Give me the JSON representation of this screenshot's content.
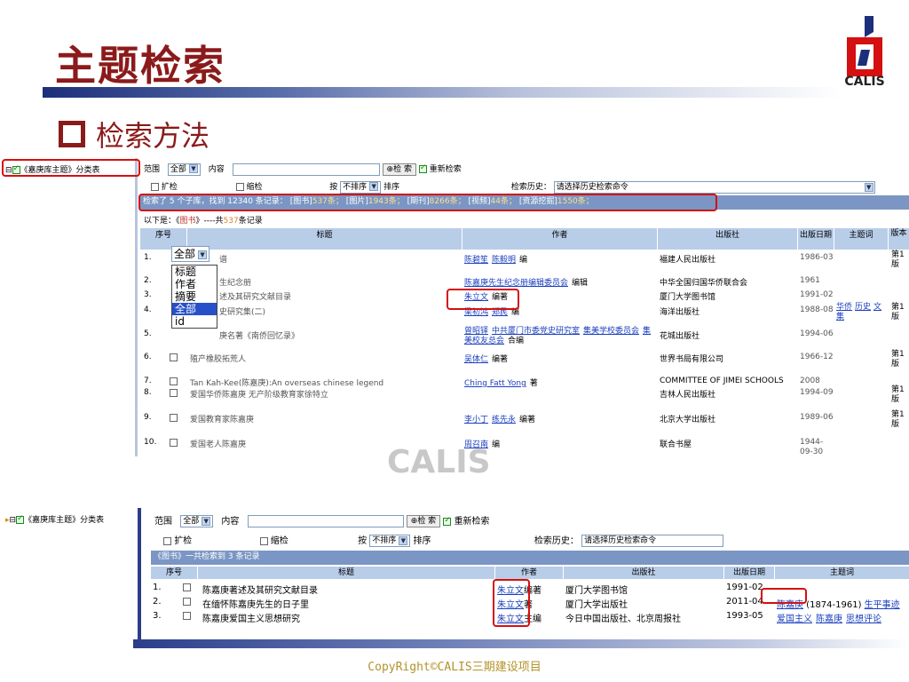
{
  "slide": {
    "title": "主题检索",
    "subtitle": "检索方法",
    "logo_text": "CALIS",
    "watermark": "CALIS",
    "copyright": "CopyRight©CALIS三期建设项目"
  },
  "colors": {
    "title": "#8b1a1a",
    "accent_blue": "#1c2f7a",
    "highlight_red": "#d41010",
    "link": "#1a3fbf"
  },
  "shot1": {
    "tree_label": "《嘉庚库主题》分类表",
    "scope_label": "范围",
    "scope_value": "全部",
    "content_label": "内容",
    "search_btn": "检 索",
    "rescan_label": "重新检索",
    "expand_label": "扩检",
    "narrow_label": "缩检",
    "by_label": "按",
    "sort_value": "不排序",
    "sort_label": "排序",
    "history_label": "检索历史：",
    "history_value": "请选择历史检索命令",
    "summary_prefix": "检索了 5 个子库，找到 12340 条记录：",
    "libs": [
      {
        "name": "图书",
        "count": "537条；"
      },
      {
        "name": "图片",
        "count": "1943条；"
      },
      {
        "name": "期刊",
        "count": "8266条；"
      },
      {
        "name": "视频",
        "count": "44条；"
      },
      {
        "name": "资源挖掘",
        "count": "1550条；"
      }
    ],
    "below_prefix": "以下是：《",
    "below_lib": "图书",
    "below_mid": "》----共",
    "below_count": "537",
    "below_suffix": "条记录",
    "headers": [
      "序号",
      "标题",
      "作者",
      "出版社",
      "出版日期",
      "主题词",
      "版本"
    ],
    "dropdown": {
      "value": "全部",
      "options": [
        "标题",
        "作者",
        "摘要",
        "全部",
        "id"
      ]
    },
    "rows": [
      {
        "no": "1.",
        "title": "谱",
        "authors": [
          "陈碧笙",
          "陈毅明"
        ],
        "role": "编",
        "pub": "福建人民出版社",
        "date": "1986-03",
        "subj": [],
        "ed": "第1版"
      },
      {
        "no": "2.",
        "title": "生纪念册",
        "authors": [
          "陈嘉庚先生纪念册编辑委员会"
        ],
        "role": "编辑",
        "pub": "中华全国归国华侨联合会",
        "date": "1961",
        "subj": [],
        "ed": ""
      },
      {
        "no": "3.",
        "title": "述及其研究文献目录",
        "authors": [
          "朱立文"
        ],
        "role": "编著",
        "pub": "厦门大学图书馆",
        "date": "1991-02",
        "subj": [],
        "ed": ""
      },
      {
        "no": "4.",
        "title": "史研究集(二)",
        "authors": [
          "梁初鸿",
          "郑民"
        ],
        "role": "编",
        "pub": "海洋出版社",
        "date": "1988-08",
        "subj": [
          "华侨",
          "历史",
          "文集"
        ],
        "ed": "第1版"
      },
      {
        "no": "5.",
        "title": "庚名著《南侨回忆录》",
        "authors": [
          "曾昭铎",
          "中共厦门市委党史研究室",
          "集美学校委员会",
          "集美校友总会"
        ],
        "role": "合编",
        "pub": "花城出版社",
        "date": "1994-06",
        "subj": [],
        "ed": ""
      },
      {
        "no": "6.",
        "title": "殖产橡胶拓荒人",
        "authors": [
          "吴体仁"
        ],
        "role": "编著",
        "pub": "世界书局有限公司",
        "date": "1966-12",
        "subj": [],
        "ed": "第1版"
      },
      {
        "no": "7.",
        "title": "Tan Kah-Kee(陈嘉庚):An overseas chinese legend",
        "authors": [
          "Ching Fatt Yong"
        ],
        "role": "著",
        "pub": "COMMITTEE OF JIMEI SCHOOLS",
        "date": "2008",
        "subj": [],
        "ed": ""
      },
      {
        "no": "8.",
        "title": "爱国华侨陈嘉庚 无产阶级教育家徐特立",
        "authors": [],
        "role": "",
        "pub": "吉林人民出版社",
        "date": "1994-09",
        "subj": [],
        "ed": "第1版"
      },
      {
        "no": "9.",
        "title": "爱国教育家陈嘉庚",
        "authors": [
          "李小丁",
          "练先永"
        ],
        "role": "编著",
        "pub": "北京大学出版社",
        "date": "1989-06",
        "subj": [],
        "ed": "第1版"
      },
      {
        "no": "10.",
        "title": "爱国老人陈嘉庚",
        "authors": [
          "周召南"
        ],
        "role": "编",
        "pub": "联合书屋",
        "date": "1944-09-30",
        "subj": [],
        "ed": ""
      }
    ]
  },
  "shot2": {
    "tree_label": "《嘉庚库主题》分类表",
    "scope_label": "范围",
    "scope_value": "全部",
    "content_label": "内容",
    "search_btn": "检 索",
    "rescan_label": "重新检索",
    "expand_label": "扩检",
    "narrow_label": "缩检",
    "by_label": "按",
    "sort_value": "不排序",
    "sort_label": "排序",
    "history_label": "检索历史：",
    "history_value": "请选择历史检索命令",
    "summary": "《图书》一共检索到 3 条记录",
    "headers": [
      "序号",
      "标题",
      "作者",
      "出版社",
      "出版日期",
      "主题词"
    ],
    "rows": [
      {
        "no": "1.",
        "title": "陈嘉庚著述及其研究文献目录",
        "author": "朱立文",
        "role": "编著",
        "pub": "厦门大学图书馆",
        "date": "1991-02",
        "subj_pre": "",
        "subj": []
      },
      {
        "no": "2.",
        "title": "在缅怀陈嘉庚先生的日子里",
        "author": "朱立文",
        "role": "著",
        "pub": "厦门大学出版社",
        "date": "2011-04",
        "subj_pre": "陈嘉庚",
        "subj_mid": " (1874-1961) ",
        "subj": [
          "生平事迹"
        ]
      },
      {
        "no": "3.",
        "title": "陈嘉庚爱国主义思想研究",
        "author": "朱立文",
        "role": "主编",
        "pub": "今日中国出版社、北京周报社",
        "date": "1993-05",
        "subj_pre": "",
        "subj": [
          "爱国主义",
          "陈嘉庚",
          "思想评论"
        ]
      }
    ]
  }
}
